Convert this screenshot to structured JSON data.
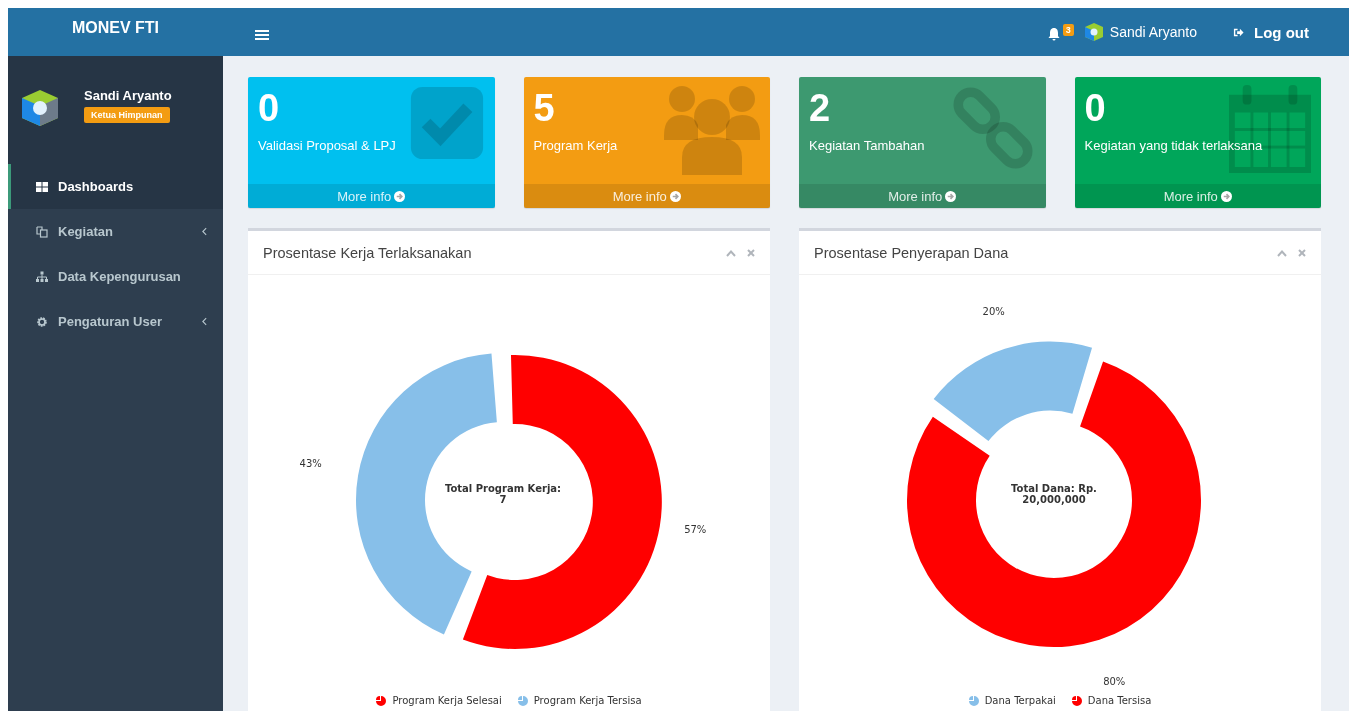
{
  "header": {
    "brand": "MONEV FTI",
    "notification_count": "3",
    "user_name": "Sandi Aryanto",
    "logout": "Log out"
  },
  "sidebar": {
    "user": {
      "name": "Sandi Aryanto",
      "role": "Ketua Himpunan"
    },
    "items": [
      {
        "label": "Dashboards",
        "selected": true,
        "has_submenu": false
      },
      {
        "label": "Kegiatan",
        "selected": false,
        "has_submenu": true
      },
      {
        "label": "Data Kepengurusan",
        "selected": false,
        "has_submenu": false
      },
      {
        "label": "Pengaturan User",
        "selected": false,
        "has_submenu": true
      }
    ]
  },
  "info_boxes": [
    {
      "value": "0",
      "label": "Validasi Proposal & LPJ",
      "link": "More info",
      "color": "#00c0ef"
    },
    {
      "value": "5",
      "label": "Program Kerja",
      "link": "More info",
      "color": "#f39c12"
    },
    {
      "value": "2",
      "label": "Kegiatan Tambahan",
      "link": "More info",
      "color": "#3d9970"
    },
    {
      "value": "0",
      "label": "Kegiatan yang tidak terlaksana",
      "link": "More info",
      "color": "#00a65a"
    }
  ],
  "panels": [
    {
      "title": "Prosentase Kerja Terlaksanakan",
      "center_label": "Total Program Kerja: 7",
      "chart_data": {
        "type": "donut",
        "categories": [
          "Program Kerja Selesai",
          "Program Kerja Tersisa"
        ],
        "values": [
          57,
          43
        ],
        "colors": [
          "#ff0000",
          "#87bfe9"
        ],
        "value_labels": [
          "57%",
          "43%"
        ],
        "legend": "bottom"
      }
    },
    {
      "title": "Prosentase Penyerapan Dana",
      "center_label": "Total Dana: Rp. 20,000,000",
      "chart_data": {
        "type": "donut",
        "categories": [
          "Dana Terpakai",
          "Dana Tersisa"
        ],
        "values": [
          20,
          80
        ],
        "colors": [
          "#87bfe9",
          "#ff0000"
        ],
        "value_labels": [
          "20%",
          "80%"
        ],
        "legend": "bottom"
      }
    }
  ]
}
